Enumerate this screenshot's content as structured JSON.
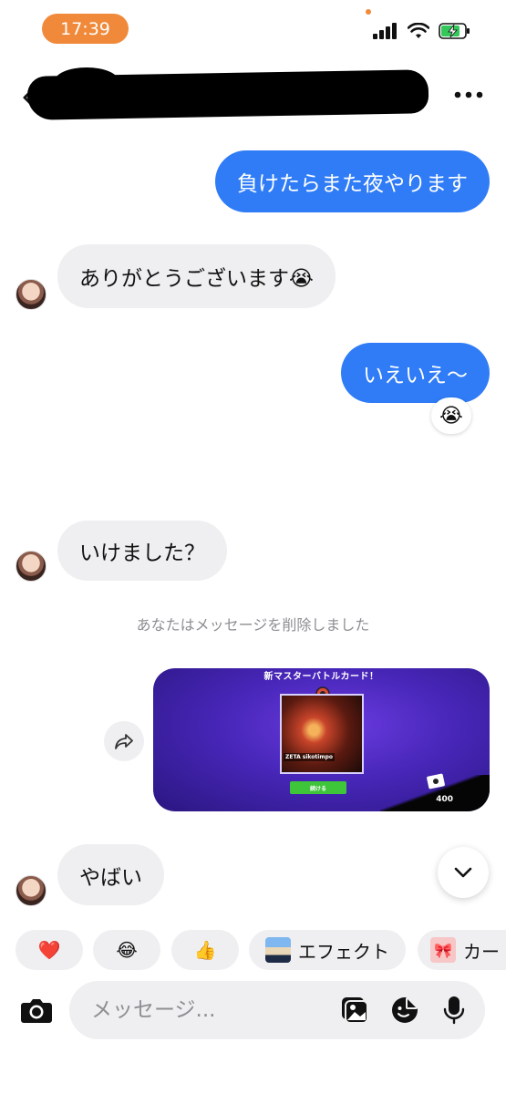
{
  "status_bar": {
    "time": "17:39"
  },
  "messages": [
    {
      "id": "m1",
      "direction": "outgoing",
      "text": "負けたらまた夜やります"
    },
    {
      "id": "m2",
      "direction": "incoming",
      "text": "ありがとうございます😭"
    },
    {
      "id": "m3",
      "direction": "outgoing",
      "text": "いえいえ〜",
      "reaction": "😭"
    },
    {
      "id": "m4",
      "direction": "incoming",
      "text": "いけました？"
    },
    {
      "id": "m5",
      "direction": "system",
      "text": "あなたはメッセージを削除しました"
    },
    {
      "id": "m6",
      "direction": "outgoing",
      "type": "image",
      "image_text": {
        "title": "新マスターバトルカード！",
        "card_name": "ZETA sikotimpo",
        "button": "続ける",
        "count": "400"
      }
    },
    {
      "id": "m7",
      "direction": "incoming",
      "text": "やばい"
    }
  ],
  "quick_reactions": [
    {
      "emoji": "❤️"
    },
    {
      "emoji": "😂"
    },
    {
      "emoji": "👍"
    },
    {
      "label": "エフェクト"
    },
    {
      "label": "カー"
    }
  ],
  "composer": {
    "placeholder": "メッセージ..."
  },
  "colors": {
    "outgoing_bubble": "#2f7cf6",
    "incoming_bubble": "#efeff1",
    "time_pill": "#f08a3a"
  }
}
